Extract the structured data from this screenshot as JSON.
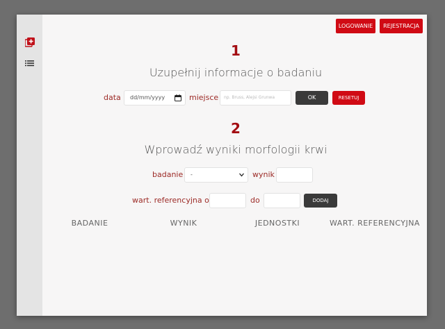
{
  "header": {
    "login_label": "LOGOWANIE",
    "register_label": "REJESTRACJA"
  },
  "sidebar": {
    "icons": [
      "add-box-icon",
      "list-icon"
    ]
  },
  "section1": {
    "number": "1",
    "title": "Uzupełnij informacje o badaniu",
    "date_label": "data",
    "date_value": "dd/mm/yyyy",
    "place_label": "miejsce",
    "place_placeholder": "np. Bruss, Alejsi Grunwa",
    "ok_label": "OK",
    "reset_label": "RESETUJ"
  },
  "section2": {
    "number": "2",
    "title": "Wprowadź wyniki morfologii krwi",
    "test_label": "badanie",
    "test_selected": "-",
    "result_label": "wynik",
    "ref_from_label": "wart. referencyjna od",
    "ref_to_label": "do",
    "add_label": "DODAJ"
  },
  "table": {
    "columns": [
      "BADANIE",
      "WYNIK",
      "JEDNOSTKI",
      "WART. REFERENCYJNA"
    ]
  },
  "colors": {
    "accent": "#d00a14",
    "heading_red": "#a30d12",
    "label": "#9c2a26",
    "dark_button": "#3a3a3a"
  }
}
